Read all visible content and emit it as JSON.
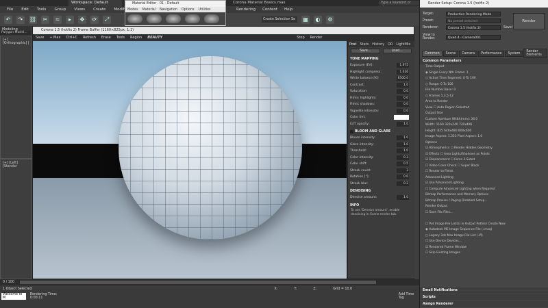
{
  "app": {
    "window_title": "Corona Material Basics.max",
    "workspace": "Workspace: Default",
    "search_placeholder": "Type a keyword or phrase",
    "menus": [
      "File",
      "Edit",
      "Tools",
      "Group",
      "Views",
      "Create",
      "Modifiers"
    ],
    "menus_right": [
      "Rendering",
      "Content",
      "Help"
    ],
    "selection_set": "Create Selection Se"
  },
  "ribbon": {
    "tab_modeling": "Modeling",
    "tab_polygon": "Polygon Model..."
  },
  "viewports": {
    "top_left": "[+] [Orthographic] [",
    "bottom_left": "[+] [Left] [Standar"
  },
  "material_editor": {
    "title": "Material Editor - 01 - Default",
    "menu": [
      "Modes",
      "Material",
      "Navigation",
      "Options",
      "Utilities"
    ]
  },
  "vfb": {
    "title": "Corona 1.5 (hotfix 2) Frame Buffer (1160×825px, 1:1)",
    "toolbar": [
      "Save",
      "+.Max",
      "Ctrl+C",
      "Refresh",
      "Erase",
      "Tools",
      "Region",
      "BEAUTY"
    ],
    "stop": "Stop",
    "render": "Render",
    "panel_tabs": [
      "Post",
      "Stats",
      "History",
      "DR",
      "LightMix"
    ],
    "save_btn": "Save...",
    "load_btn": "Load...",
    "tone_mapping_title": "TONE MAPPING",
    "tone_mapping": [
      {
        "label": "Exposure (EV):",
        "value": "1.675"
      },
      {
        "label": "Highlight compress:",
        "value": "1.026"
      },
      {
        "label": "White balance [K]:",
        "value": "6500.0"
      },
      {
        "label": "Contrast:",
        "value": "1.0"
      },
      {
        "label": "Saturation:",
        "value": "0.0"
      },
      {
        "label": "Filmic highlights:",
        "value": "0.0"
      },
      {
        "label": "Filmic shadows:",
        "value": "0.0"
      },
      {
        "label": "Vignette intensity:",
        "value": "0.0"
      },
      {
        "label": "Color tint:",
        "value": ""
      },
      {
        "label": "LUT opacity:",
        "value": "1.0"
      }
    ],
    "bloom_title": "BLOOM AND GLARE",
    "bloom": [
      {
        "label": "Bloom intensity:",
        "value": "1.0"
      },
      {
        "label": "Glare intensity:",
        "value": "1.0"
      },
      {
        "label": "Threshold:",
        "value": "1.0"
      },
      {
        "label": "Color intensity:",
        "value": "0.3"
      },
      {
        "label": "Color shift:",
        "value": "0.5"
      },
      {
        "label": "Streak count:",
        "value": "3"
      },
      {
        "label": "Rotation [°]:",
        "value": "0.0"
      },
      {
        "label": "Streak blur:",
        "value": "0.2"
      }
    ],
    "denoise_title": "DENOISING",
    "denoise_label": "Denoise amount:",
    "denoise_value": "1.0",
    "info_title": "INFO",
    "info_text": "To use 'Denoise amount', enable denoising in Scene render tab."
  },
  "render_setup": {
    "title": "Render Setup: Corona 1.5 (hotfix 2)",
    "target_label": "Target:",
    "target_value": "Production Rendering Mode",
    "preset_label": "Preset:",
    "preset_value": "No preset selected",
    "renderer_label": "Renderer:",
    "renderer_value": "Corona 1.5 (hotfix 2)",
    "save_file": "Save File",
    "view_label": "View to Render:",
    "view_value": "Quad 4 - Camera001",
    "render_btn": "Render",
    "tabs": [
      "Common",
      "Scene",
      "Camera",
      "Performance",
      "System",
      "Render Elements"
    ],
    "common_params": "Common Parameters",
    "lines": [
      "Time Output",
      "◉ Single                    Every Nth Frame: 1",
      "○ Active Time Segment:   0 To 100",
      "○ Range:   0   To   100",
      "                File Number Base: 0",
      "○ Frames   1,3,5-12",
      "Area to Render",
      "View              ☐ Auto Region Selected",
      "Output Size",
      "Custom          Aperture Width(mm): 36.0",
      "Width:    1160       320x240    720x486",
      "Height:   825        640x480    800x600",
      "Image Aspect: 1.333   Pixel Aspect: 1.0",
      "Options",
      "☑ Atmospherics    ☐ Render Hidden Geometry",
      "☑ Effects            ☐ Area Lights/Shadows as Points",
      "☑ Displacement    ☐ Force 2-Sided",
      "☐ Video Color Check   ☐ Super Black",
      "☐ Render to Fields",
      "Advanced Lighting",
      "☑ Use Advanced Lighting",
      "☐ Compute Advanced Lighting when Required",
      "Bitmap Performance and Memory Options",
      "Bitmap Proxies / Paging Disabled     Setup...",
      "Render Output",
      "☐ Save File                          Files...",
      "",
      "☐ Put Image File List(s) in Output Path(s)   Create Now",
      "   ◉ Autodesk ME Image Sequence File (.imsq)",
      "   ○ Legacy 3ds Max Image File List (.ifl)",
      "☐ Use Device                          Devices...",
      "☑ Rendered Frame Window",
      "☐ Skip Existing Images"
    ],
    "sections_bottom": [
      "Email Notifications",
      "Scripts",
      "Assign Renderer"
    ]
  },
  "status": {
    "frame": "0 / 100",
    "selected": "1 Object Selected",
    "rendering_time": "Rendering Time: 0:00:11",
    "welcome": "Welcome to M",
    "grid": "Grid = 10.0",
    "add_time_tag": "Add Time Tag",
    "x_label": "X:",
    "y_label": "Y:",
    "z_label": "Z:"
  }
}
